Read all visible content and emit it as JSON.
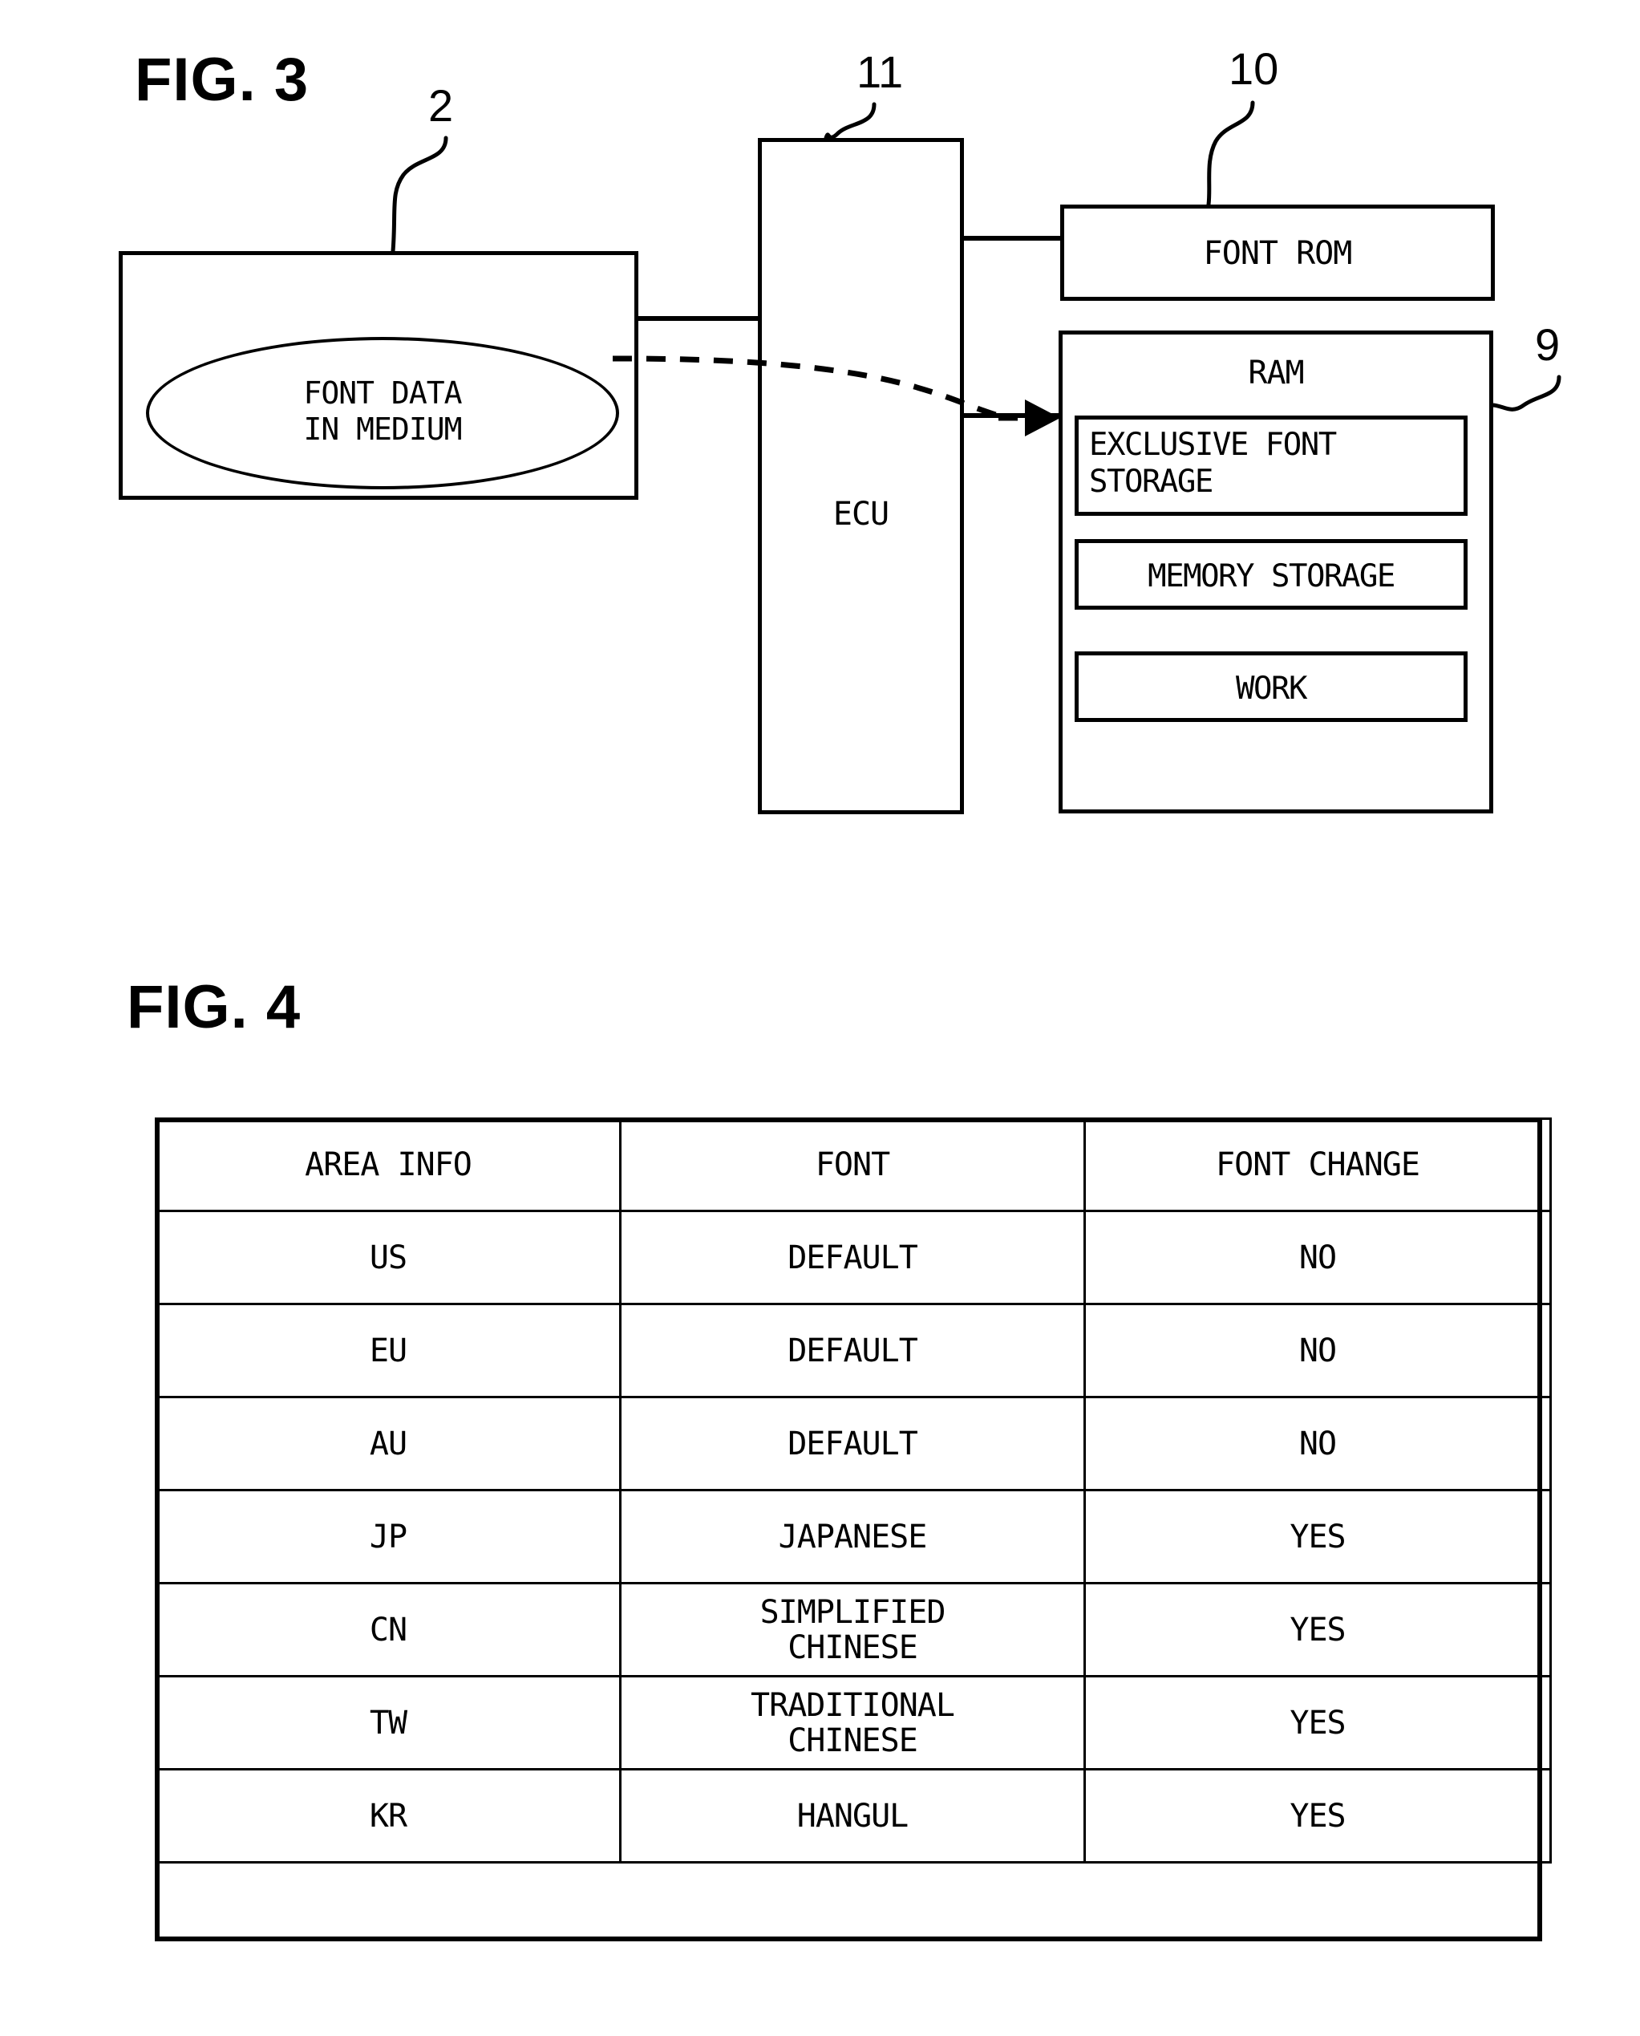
{
  "figures": [
    {
      "title": "FIG. 3",
      "nodes": {
        "medium": {
          "ref": "2",
          "ellipse_label": "FONT DATA\nIN MEDIUM"
        },
        "ecu": {
          "ref": "11",
          "label": "ECU"
        },
        "font_rom": {
          "ref": "10",
          "label": "FONT ROM"
        },
        "ram": {
          "ref": "9",
          "label": "RAM",
          "slots": [
            {
              "label": "EXCLUSIVE FONT\nSTORAGE"
            },
            {
              "label": "MEMORY STORAGE"
            },
            {
              "label": "WORK"
            }
          ]
        }
      }
    },
    {
      "title": "FIG. 4",
      "table": {
        "headers": [
          "AREA INFO",
          "FONT",
          "FONT CHANGE"
        ],
        "rows": [
          [
            "US",
            "DEFAULT",
            "NO"
          ],
          [
            "EU",
            "DEFAULT",
            "NO"
          ],
          [
            "AU",
            "DEFAULT",
            "NO"
          ],
          [
            "JP",
            "JAPANESE",
            "YES"
          ],
          [
            "CN",
            "SIMPLIFIED\nCHINESE",
            "YES"
          ],
          [
            "TW",
            "TRADITIONAL\nCHINESE",
            "YES"
          ],
          [
            "KR",
            "HANGUL",
            "YES"
          ]
        ]
      }
    }
  ],
  "colors": {
    "ink": "#000000",
    "paper": "#ffffff"
  }
}
